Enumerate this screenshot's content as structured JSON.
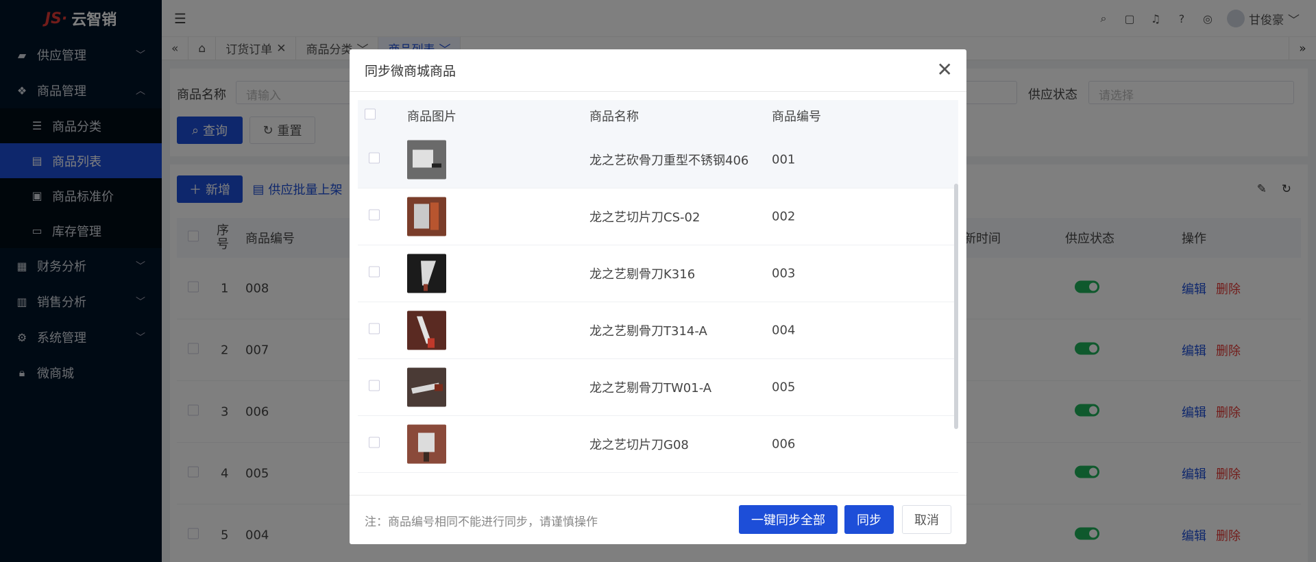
{
  "app": {
    "logo_text": "云智销",
    "logo_mark": "JS·"
  },
  "sidebar": {
    "items": [
      {
        "label": "供应管理",
        "icon": "supply-icon",
        "expanded": false
      },
      {
        "label": "商品管理",
        "icon": "goods-icon",
        "expanded": true,
        "children": [
          {
            "label": "商品分类",
            "icon": "sliders-icon"
          },
          {
            "label": "商品列表",
            "icon": "list-doc-icon",
            "active": true
          },
          {
            "label": "商品标准价",
            "icon": "price-icon"
          },
          {
            "label": "库存管理",
            "icon": "store-icon"
          }
        ]
      },
      {
        "label": "财务分析",
        "icon": "finance-icon",
        "expanded": false
      },
      {
        "label": "销售分析",
        "icon": "bar-chart-icon",
        "expanded": false
      },
      {
        "label": "系统管理",
        "icon": "gear-icon",
        "expanded": false
      },
      {
        "label": "微商城",
        "icon": "lock-bag-icon"
      }
    ]
  },
  "header": {
    "user_name": "甘俊豪"
  },
  "tabs": [
    {
      "label": "订货订单",
      "closable": true
    },
    {
      "label": "商品分类",
      "closable": true
    },
    {
      "label": "商品列表",
      "closable": true,
      "active": true
    }
  ],
  "search": {
    "name_label": "商品名称",
    "name_placeholder": "请输入",
    "status_label": "供应状态",
    "status_placeholder": "请选择",
    "query_btn": "查询",
    "reset_btn": "重置"
  },
  "toolbar": {
    "add_btn": "新增",
    "batch_btn": "供应批量上架"
  },
  "table": {
    "headers": {
      "index": "序号",
      "code": "商品编号",
      "update_time": "新时间",
      "status": "供应状态",
      "ops": "操作"
    },
    "rows": [
      {
        "index": "1",
        "code": "008"
      },
      {
        "index": "2",
        "code": "007"
      },
      {
        "index": "3",
        "code": "006"
      },
      {
        "index": "4",
        "code": "005"
      },
      {
        "index": "5",
        "code": "004"
      }
    ],
    "edit_label": "编辑",
    "delete_label": "删除"
  },
  "modal": {
    "title": "同步微商城商品",
    "headers": {
      "image": "商品图片",
      "name": "商品名称",
      "code": "商品编号"
    },
    "rows": [
      {
        "name": "龙之艺砍骨刀重型不锈钢406",
        "code": "001",
        "thumb_color": "#6a6a6a"
      },
      {
        "name": "龙之艺切片刀CS-02",
        "code": "002",
        "thumb_color": "#7a3d2a"
      },
      {
        "name": "龙之艺剔骨刀K316",
        "code": "003",
        "thumb_color": "#1b1b1b"
      },
      {
        "name": "龙之艺剔骨刀T314-A",
        "code": "004",
        "thumb_color": "#5a2a22"
      },
      {
        "name": "龙之艺剔骨刀TW01-A",
        "code": "005",
        "thumb_color": "#4a3a35"
      },
      {
        "name": "龙之艺切片刀G08",
        "code": "006",
        "thumb_color": "#8a4a3a"
      }
    ],
    "note": "注：商品编号相同不能进行同步，请谨慎操作",
    "sync_all_btn": "一键同步全部",
    "sync_btn": "同步",
    "cancel_btn": "取消"
  },
  "colors": {
    "primary": "#1d4ed8",
    "danger": "#e53935",
    "success": "#1fb35a",
    "sidebar_bg": "#001529"
  }
}
